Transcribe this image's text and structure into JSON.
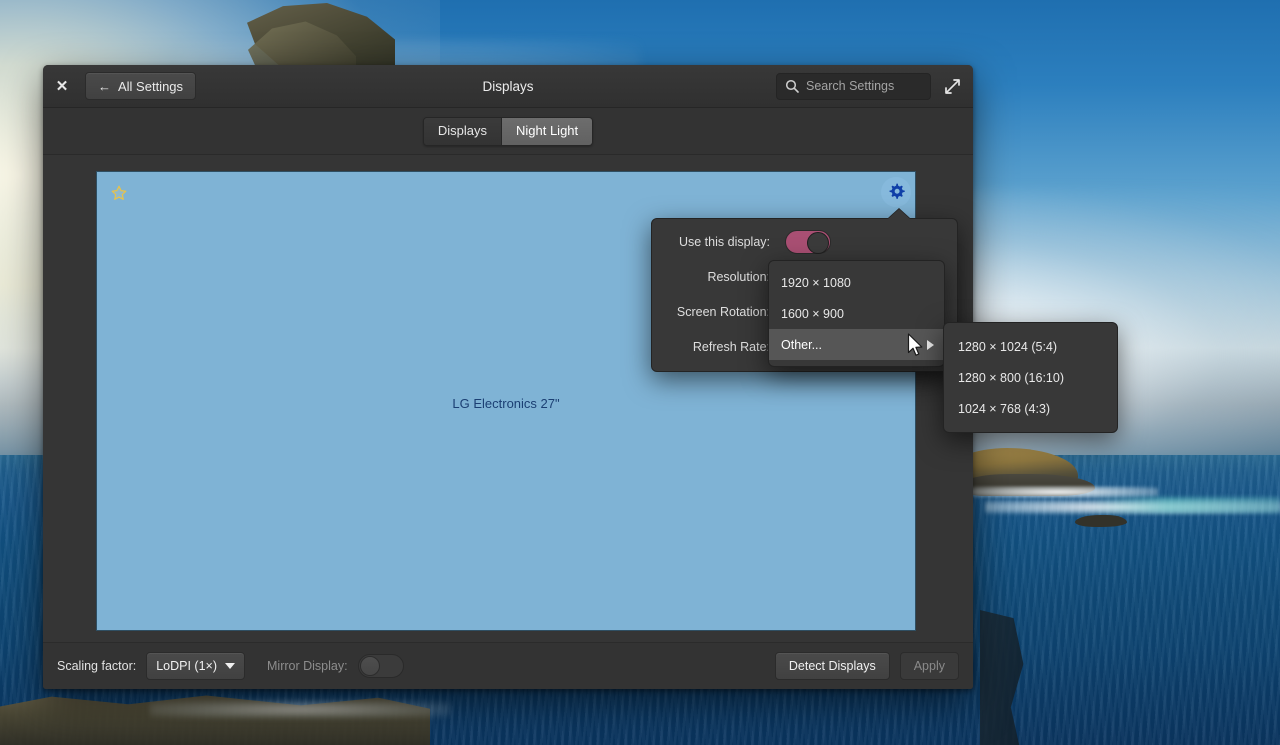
{
  "desktop": {
    "wallpaper_description": "coastal cliff and ocean seascape",
    "sky_color": "#2c7fbe",
    "sea_color": "#125283"
  },
  "window": {
    "title": "Displays",
    "close_label": "✕",
    "back_button": {
      "label": "All Settings",
      "arrow": "←"
    },
    "search": {
      "value": "",
      "placeholder": "Search Settings"
    },
    "maximize_label": "maximize"
  },
  "tabs": [
    {
      "id": "displays",
      "label": "Displays",
      "active": false
    },
    {
      "id": "night-light",
      "label": "Night Light",
      "active": true
    }
  ],
  "monitor": {
    "name": "LG Electronics 27\"",
    "fill_color": "#7fb3d5",
    "label_color": "#1b3f73",
    "primary_star": "star-icon",
    "gear": "gear-icon"
  },
  "actionbar": {
    "scaling_label": "Scaling factor:",
    "scaling_value": "LoDPI (1×)",
    "mirror_label": "Mirror Display:",
    "mirror_enabled": false,
    "detect_label": "Detect Displays",
    "apply_label": "Apply",
    "apply_disabled": true
  },
  "popover": {
    "rows": [
      {
        "id": "use-this-display",
        "label": "Use this display:",
        "type": "toggle",
        "value": true,
        "toggle_color": "#a94f73"
      },
      {
        "id": "resolution",
        "label": "Resolution:",
        "type": "combo"
      },
      {
        "id": "screen-rotation",
        "label": "Screen Rotation:",
        "type": "combo"
      },
      {
        "id": "refresh-rate",
        "label": "Refresh Rate:",
        "type": "combo"
      }
    ]
  },
  "resolution_menu": {
    "items": [
      {
        "label": "1920 × 1080",
        "highlighted": false,
        "submenu": false
      },
      {
        "label": "1600 × 900",
        "highlighted": false,
        "submenu": false
      },
      {
        "label": "Other...",
        "highlighted": true,
        "submenu": true
      }
    ]
  },
  "resolution_submenu": {
    "items": [
      {
        "label": "1280 × 1024 (5:4)"
      },
      {
        "label": "1280 × 800 (16:10)"
      },
      {
        "label": "1024 × 768 (4:3)"
      }
    ]
  }
}
